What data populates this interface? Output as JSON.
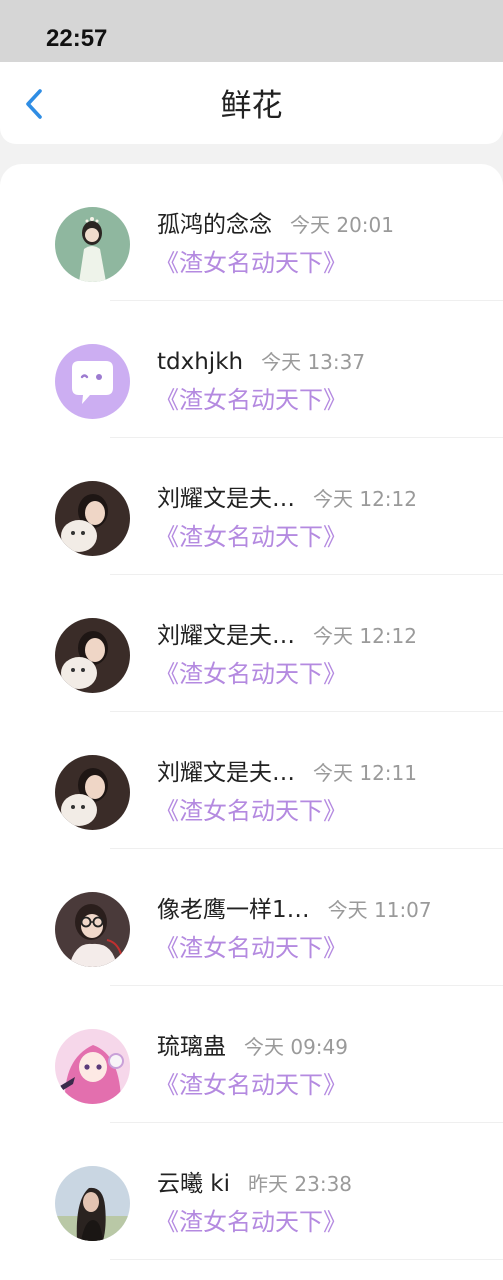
{
  "status_bar": {
    "time": "22:57"
  },
  "header": {
    "title": "鲜花"
  },
  "items": [
    {
      "name": "孤鸿的念念",
      "time": "今天 20:01",
      "book": "《渣女名动天下》",
      "avatar_icon": "girl-green-background-avatar",
      "colors": {
        "bg": "#8fb79f",
        "accent": "#eef3ea"
      }
    },
    {
      "name": "tdxhjkh",
      "time": "今天 13:37",
      "book": "《渣女名动天下》",
      "avatar_icon": "default-purple-chat-avatar",
      "colors": {
        "bg": "#ccaef2",
        "accent": "#ffffff"
      }
    },
    {
      "name": "刘耀文是夫…",
      "time": "今天 12:12",
      "book": "《渣女名动天下》",
      "avatar_icon": "girl-holding-white-dog-avatar",
      "colors": {
        "bg": "#3a2c28",
        "accent": "#f2ece6"
      }
    },
    {
      "name": "刘耀文是夫…",
      "time": "今天 12:12",
      "book": "《渣女名动天下》",
      "avatar_icon": "girl-holding-white-dog-avatar",
      "colors": {
        "bg": "#3a2c28",
        "accent": "#f2ece6"
      }
    },
    {
      "name": "刘耀文是夫…",
      "time": "今天 12:11",
      "book": "《渣女名动天下》",
      "avatar_icon": "girl-holding-white-dog-avatar",
      "colors": {
        "bg": "#3a2c28",
        "accent": "#f2ece6"
      }
    },
    {
      "name": "像老鹰一样1…",
      "time": "今天 11:07",
      "book": "《渣女名动天下》",
      "avatar_icon": "girl-with-glasses-avatar",
      "colors": {
        "bg": "#4a3a3a",
        "accent": "#f4ecea"
      }
    },
    {
      "name": "琉璃蛊",
      "time": "今天 09:49",
      "book": "《渣女名动天下》",
      "avatar_icon": "anime-pink-hair-girl-avatar",
      "colors": {
        "bg": "#f6d7ea",
        "accent": "#e36fae"
      }
    },
    {
      "name": "云曦 ki",
      "time": "昨天 23:38",
      "book": "《渣女名动天下》",
      "avatar_icon": "girl-dark-hair-sky-avatar",
      "colors": {
        "bg": "#c9d6e2",
        "accent": "#2a2320"
      }
    }
  ],
  "colors": {
    "accent_purple": "#b48ae0",
    "back_blue": "#2f8de4",
    "status_bar_bg": "#d6d6d6"
  }
}
